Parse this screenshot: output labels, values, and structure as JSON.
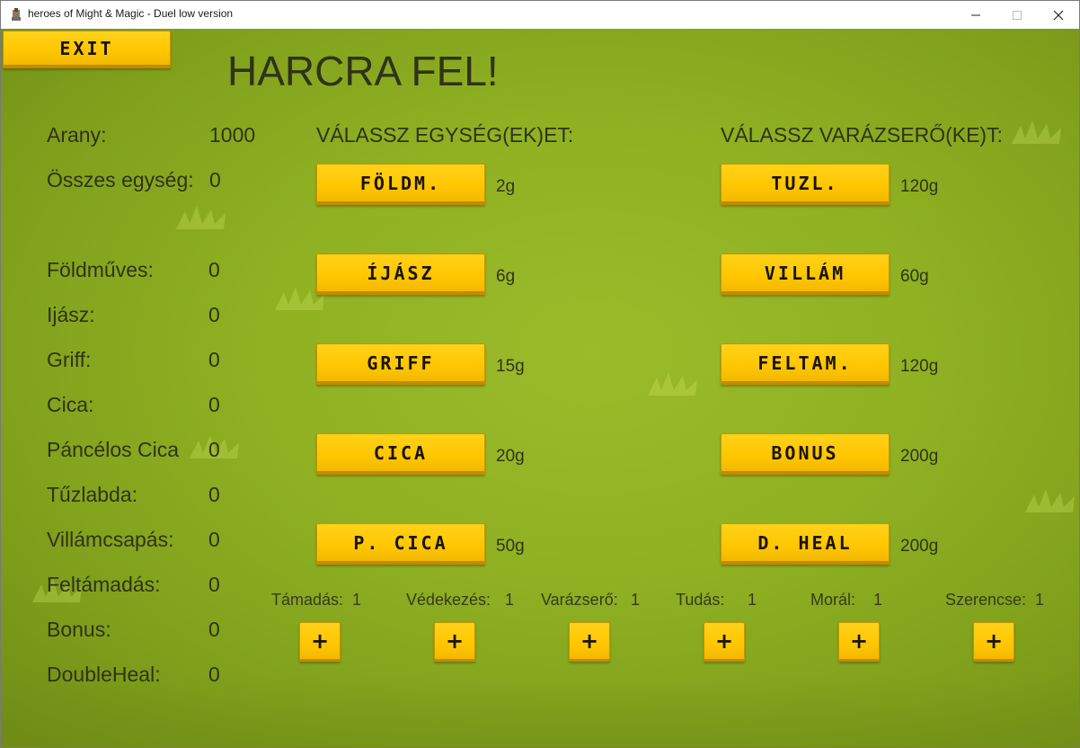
{
  "window": {
    "title": "heroes of Might & Magic - Duel low version"
  },
  "exit_button": {
    "label": "EXIT"
  },
  "heading": "HARCRA FEL!",
  "gold": {
    "label": "Arany:",
    "value": "1000"
  },
  "total_units": {
    "label": "Összes egység:",
    "value": "0"
  },
  "counts": [
    {
      "label": "Földműves:",
      "value": "0"
    },
    {
      "label": "Ijász:",
      "value": "0"
    },
    {
      "label": "Griff:",
      "value": "0"
    },
    {
      "label": "Cica:",
      "value": "0"
    },
    {
      "label": "Páncélos Cica",
      "value": "0"
    },
    {
      "label": "Tűzlabda:",
      "value": "0"
    },
    {
      "label": "Villámcsapás:",
      "value": "0"
    },
    {
      "label": "Feltámadás:",
      "value": "0"
    },
    {
      "label": "Bonus:",
      "value": "0"
    },
    {
      "label": "DoubleHeal:",
      "value": "0"
    }
  ],
  "units_header": "VÁLASSZ EGYSÉG(EK)ET:",
  "units": [
    {
      "label": "FÖLDM.",
      "price": "2g"
    },
    {
      "label": "ÍJÁSZ",
      "price": "6g"
    },
    {
      "label": "GRIFF",
      "price": "15g"
    },
    {
      "label": "CICA",
      "price": "20g"
    },
    {
      "label": "P. CICA",
      "price": "50g"
    }
  ],
  "spells_header": "VÁLASSZ VARÁZSERŐ(KE)T:",
  "spells": [
    {
      "label": "TUZL.",
      "price": "120g"
    },
    {
      "label": "VILLÁM",
      "price": "60g"
    },
    {
      "label": "FELTAM.",
      "price": "120g"
    },
    {
      "label": "BONUS",
      "price": "200g"
    },
    {
      "label": "D. HEAL",
      "price": "200g"
    }
  ],
  "stats": [
    {
      "label": "Támadás:",
      "value": "1"
    },
    {
      "label": "Védekezés:",
      "value": "1"
    },
    {
      "label": "Varázserő:",
      "value": "1"
    },
    {
      "label": "Tudás:",
      "value": "1"
    },
    {
      "label": "Morál:",
      "value": "1"
    },
    {
      "label": "Szerencse:",
      "value": "1"
    }
  ],
  "plus_label": "+"
}
